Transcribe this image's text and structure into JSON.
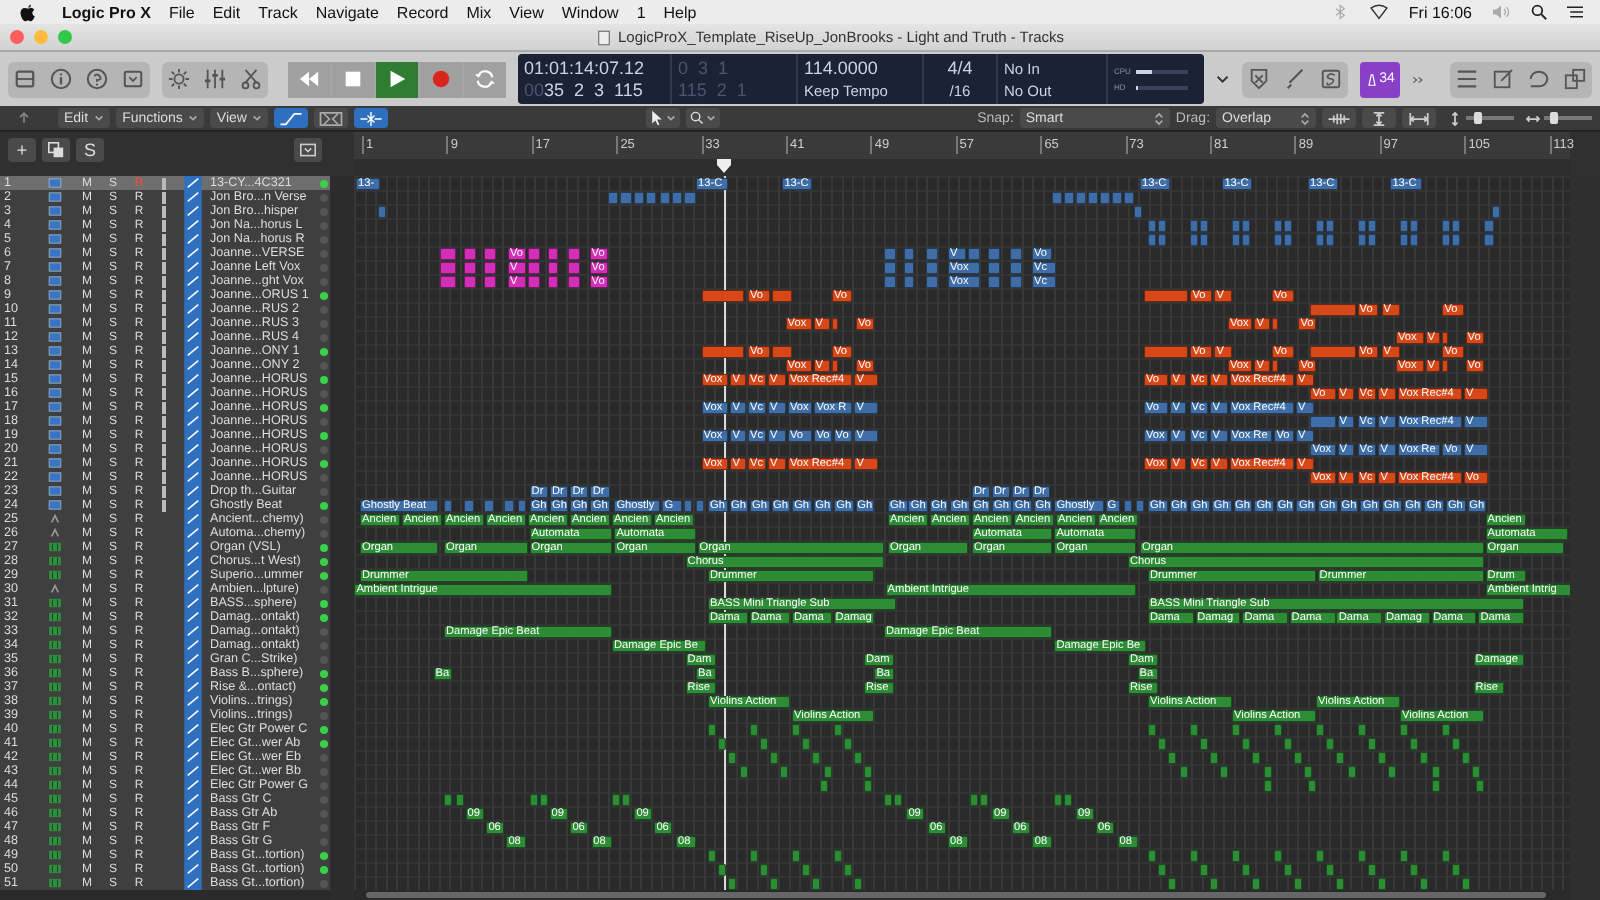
{
  "menubar": {
    "app": "Logic Pro X",
    "items": [
      "File",
      "Edit",
      "Track",
      "Navigate",
      "Record",
      "Mix",
      "View",
      "Window",
      "1",
      "Help"
    ],
    "clock": "Fri 16:06"
  },
  "window": {
    "title": "LogicProX_Template_RiseUp_JonBrooks - Light and Truth - Tracks"
  },
  "lcd": {
    "time": "01:01:14:07.12",
    "bars_prefix": "00",
    "bars": "35  2  3  115",
    "locator_1": "0  3  1",
    "locator_2": "115  2  1",
    "tempo": "114.0000",
    "tempo_mode": "Keep Tempo",
    "signature": "4/4",
    "division": "/16",
    "input": "No In",
    "output": "No Out",
    "meters": [
      {
        "label": "CPU",
        "level": 0.3
      },
      {
        "label": "HD",
        "level": 0.05
      }
    ]
  },
  "tuner_badge": "34",
  "toolbar": {
    "menus": [
      "Edit",
      "Functions",
      "View"
    ],
    "snap_label": "Snap:",
    "snap": "Smart",
    "drag_label": "Drag:",
    "drag": "Overlap",
    "sliders": [
      {
        "level": 0.25
      },
      {
        "level": 0.2
      }
    ]
  },
  "track_header": {
    "add": "+",
    "solo": "S"
  },
  "ruler": [
    "1",
    "9",
    "17",
    "25",
    "33",
    "41",
    "49",
    "57",
    "65",
    "73",
    "81",
    "89",
    "97",
    "105",
    "113"
  ],
  "tracks": [
    {
      "number": "1",
      "name": "13-CY...4C321",
      "kind": "audio",
      "buttons": [
        "M",
        "S",
        "R"
      ],
      "armed": true,
      "selected": true,
      "active": true,
      "color": "#3f6ea6",
      "regions": [
        "13-",
        "13-C",
        "13-C",
        "13-C",
        "13-C",
        "13-C",
        "13-C"
      ]
    },
    {
      "number": "2",
      "name": "Jon Bro...n Verse",
      "kind": "audio",
      "buttons": [
        "M",
        "S",
        "R"
      ],
      "armed": false,
      "selected": false,
      "active": false,
      "color": "#3f6ea6"
    },
    {
      "number": "3",
      "name": "Jon Bro...hisper",
      "kind": "audio",
      "buttons": [
        "M",
        "S",
        "R"
      ],
      "armed": false,
      "selected": false,
      "active": false,
      "color": "#3f6ea6"
    },
    {
      "number": "4",
      "name": "Jon Na...horus L",
      "kind": "audio",
      "buttons": [
        "M",
        "S",
        "R"
      ],
      "armed": false,
      "selected": false,
      "active": false,
      "color": "#3f6ea6"
    },
    {
      "number": "5",
      "name": "Jon Na...horus R",
      "kind": "audio",
      "buttons": [
        "M",
        "S",
        "R"
      ],
      "armed": false,
      "selected": false,
      "active": false,
      "color": "#3f6ea6"
    },
    {
      "number": "6",
      "name": "Joanne...VERSE",
      "kind": "audio",
      "buttons": [
        "M",
        "S",
        "R"
      ],
      "armed": false,
      "selected": false,
      "active": false,
      "color": "#3f6ea6",
      "alt": {
        "color": "#d12fb5"
      },
      "regions": [
        "Vo",
        "Vo",
        "V",
        "Vo"
      ]
    },
    {
      "number": "7",
      "name": "Joanne Left Vox",
      "kind": "audio",
      "buttons": [
        "M",
        "S",
        "R"
      ],
      "armed": false,
      "selected": false,
      "active": false,
      "color": "#3f6ea6",
      "alt": {
        "color": "#d12fb5"
      },
      "regions": [
        "V",
        "Vo",
        "Vox",
        "Vc"
      ]
    },
    {
      "number": "8",
      "name": "Joanne...ght Vox",
      "kind": "audio",
      "buttons": [
        "M",
        "S",
        "R"
      ],
      "armed": false,
      "selected": false,
      "active": false,
      "color": "#3f6ea6",
      "alt": {
        "color": "#d12fb5"
      },
      "regions": [
        "V",
        "Vo",
        "Vox",
        "Vc"
      ]
    },
    {
      "number": "9",
      "name": "Joanne...ORUS 1",
      "kind": "audio",
      "buttons": [
        "M",
        "S",
        "R"
      ],
      "armed": false,
      "selected": false,
      "active": true,
      "color": "#d4481a",
      "regions": [
        "Vo",
        "Vo",
        "Vo",
        "V",
        "Vo"
      ]
    },
    {
      "number": "10",
      "name": "Joanne...RUS 2",
      "kind": "audio",
      "buttons": [
        "M",
        "S",
        "R"
      ],
      "armed": false,
      "selected": false,
      "active": false,
      "color": "#d4481a",
      "regions": [
        "Vo",
        "V",
        "Vo"
      ]
    },
    {
      "number": "11",
      "name": "Joanne...RUS 3",
      "kind": "audio",
      "buttons": [
        "M",
        "S",
        "R"
      ],
      "armed": false,
      "selected": false,
      "active": false,
      "color": "#d4481a",
      "regions": [
        "Vox",
        "V",
        "Vo",
        "Vox",
        "V",
        "Vo"
      ]
    },
    {
      "number": "12",
      "name": "Joanne...RUS 4",
      "kind": "audio",
      "buttons": [
        "M",
        "S",
        "R"
      ],
      "armed": false,
      "selected": false,
      "active": false,
      "color": "#d4481a",
      "regions": [
        "Vox",
        "V",
        "Vo"
      ]
    },
    {
      "number": "13",
      "name": "Joanne...ONY 1",
      "kind": "audio",
      "buttons": [
        "M",
        "S",
        "R"
      ],
      "armed": false,
      "selected": false,
      "active": true,
      "color": "#d4481a",
      "regions": [
        "Vo",
        "Vo",
        "Vo",
        "V",
        "Vo",
        "Vo",
        "V",
        "Vo"
      ]
    },
    {
      "number": "14",
      "name": "Joanne...ONY 2",
      "kind": "audio",
      "buttons": [
        "M",
        "S",
        "R"
      ],
      "armed": false,
      "selected": false,
      "active": false,
      "color": "#d4481a",
      "regions": [
        "Vox",
        "V",
        "Vo",
        "Vox",
        "V",
        "Vo",
        "Vox",
        "V",
        "Vo"
      ]
    },
    {
      "number": "15",
      "name": "Joanne...HORUS",
      "kind": "audio",
      "buttons": [
        "M",
        "S",
        "R"
      ],
      "armed": false,
      "selected": false,
      "active": true,
      "color": "#d4481a",
      "regions": [
        "Vox",
        "V",
        "Vc",
        "V",
        "Vox Rec#4",
        "V",
        "Vo",
        "V",
        "Vc",
        "V",
        "Vox Rec#4",
        "V"
      ]
    },
    {
      "number": "16",
      "name": "Joanne...HORUS",
      "kind": "audio",
      "buttons": [
        "M",
        "S",
        "R"
      ],
      "armed": false,
      "selected": false,
      "active": false,
      "color": "#d4481a",
      "regions": [
        "Vo",
        "V",
        "Vc",
        "V",
        "Vox Rec#4",
        "V"
      ]
    },
    {
      "number": "17",
      "name": "Joanne...HORUS",
      "kind": "audio",
      "buttons": [
        "M",
        "S",
        "R"
      ],
      "armed": false,
      "selected": false,
      "active": true,
      "color": "#3f6ea6",
      "regions": [
        "Vox",
        "V",
        "Vc",
        "V",
        "Vox",
        "Vox R",
        "V",
        "Vo",
        "V",
        "Vc",
        "V",
        "Vox Rec#4",
        "V"
      ]
    },
    {
      "number": "18",
      "name": "Joanne...HORUS",
      "kind": "audio",
      "buttons": [
        "M",
        "S",
        "R"
      ],
      "armed": false,
      "selected": false,
      "active": false,
      "color": "#3f6ea6",
      "regions": [
        "V",
        "Vc",
        "V",
        "Vox Rec#4",
        "V"
      ]
    },
    {
      "number": "19",
      "name": "Joanne...HORUS",
      "kind": "audio",
      "buttons": [
        "M",
        "S",
        "R"
      ],
      "armed": false,
      "selected": false,
      "active": true,
      "color": "#3f6ea6",
      "regions": [
        "Vox",
        "V",
        "Vc",
        "V",
        "Vo",
        "Vo",
        "Vo",
        "V",
        "Vox",
        "V",
        "Vc",
        "V",
        "Vox Re",
        "Vo",
        "V"
      ]
    },
    {
      "number": "20",
      "name": "Joanne...HORUS",
      "kind": "audio",
      "buttons": [
        "M",
        "S",
        "R"
      ],
      "armed": false,
      "selected": false,
      "active": false,
      "color": "#3f6ea6",
      "regions": [
        "Vox",
        "V",
        "Vc",
        "V",
        "Vox Re",
        "Vo",
        "V"
      ]
    },
    {
      "number": "21",
      "name": "Joanne...HORUS",
      "kind": "audio",
      "buttons": [
        "M",
        "S",
        "R"
      ],
      "armed": false,
      "selected": false,
      "active": true,
      "color": "#d4481a",
      "regions": [
        "Vox",
        "V",
        "Vc",
        "V",
        "Vox Rec#4",
        "V",
        "Vox",
        "V",
        "Vc",
        "V",
        "Vox Rec#4",
        "V"
      ]
    },
    {
      "number": "22",
      "name": "Joanne...HORUS",
      "kind": "audio",
      "buttons": [
        "M",
        "S",
        "R"
      ],
      "armed": false,
      "selected": false,
      "active": false,
      "color": "#d4481a",
      "regions": [
        "Vox",
        "V",
        "Vc",
        "V",
        "Vox Rec#4",
        "Vo"
      ]
    },
    {
      "number": "23",
      "name": "Drop th...Guitar",
      "kind": "audio",
      "buttons": [
        "M",
        "S",
        "R"
      ],
      "armed": false,
      "selected": false,
      "active": false,
      "color": "#3f6ea6",
      "regions": [
        "Dr",
        "Dr",
        "Dr",
        "Dr",
        "Dr",
        "Dr",
        "Dr",
        "Dr"
      ]
    },
    {
      "number": "24",
      "name": "Ghostly Beat",
      "kind": "audio",
      "buttons": [
        "M",
        "S",
        "R"
      ],
      "armed": false,
      "selected": false,
      "active": true,
      "color": "#3f6ea6",
      "regions": [
        "Ghostly Beat",
        "Gh",
        "Gh",
        "Gh",
        "Gh",
        "Ghostly",
        "G",
        "Gh",
        "Gh",
        "Gh",
        "Gh",
        "Gh",
        "Gh",
        "Gh",
        "Gh",
        "Gh",
        "Gh",
        "Gh",
        "Gh",
        "Gh",
        "Gh",
        "Gh",
        "Gh",
        "Ghostly",
        "G",
        "Gh",
        "Gh",
        "Gh",
        "Gh",
        "Gh",
        "Gh",
        "Gh",
        "Gh",
        "Gh",
        "Gh",
        "Gh",
        "Gh",
        "Gh",
        "Gh",
        "Gh",
        "Gh"
      ]
    },
    {
      "number": "25",
      "name": "Ancient...chemy)",
      "kind": "aux",
      "buttons": [
        "M",
        "S",
        "R"
      ],
      "armed": false,
      "selected": false,
      "active": false,
      "color": "#2e8b36",
      "regions": [
        "Ancien",
        "Ancien",
        "Ancien",
        "Ancien",
        "Ancien",
        "Ancien",
        "Ancien",
        "Ancien",
        "Ancien",
        "Ancien",
        "Ancien",
        "Ancien",
        "Ancien",
        "Ancien",
        "Ancien"
      ]
    },
    {
      "number": "26",
      "name": "Automa...chemy)",
      "kind": "aux",
      "buttons": [
        "M",
        "S",
        "R"
      ],
      "armed": false,
      "selected": false,
      "active": false,
      "color": "#2e8b36",
      "regions": [
        "Automata",
        "Automata",
        "Automata",
        "Automata",
        "Automata"
      ]
    },
    {
      "number": "27",
      "name": "Organ (VSL)",
      "kind": "instrument",
      "buttons": [
        "M",
        "S",
        "R"
      ],
      "armed": false,
      "selected": false,
      "active": true,
      "color": "#2e8b36",
      "regions": [
        "Organ",
        "Organ",
        "Organ",
        "Organ",
        "Organ",
        "Organ",
        "Organ",
        "Organ",
        "Organ",
        "Organ"
      ]
    },
    {
      "number": "28",
      "name": "Chorus...t West)",
      "kind": "instrument",
      "buttons": [
        "M",
        "S",
        "R"
      ],
      "armed": false,
      "selected": false,
      "active": true,
      "color": "#2e8b36",
      "regions": [
        "Chorus",
        "Chorus"
      ]
    },
    {
      "number": "29",
      "name": "Superio...ummer",
      "kind": "instrument",
      "buttons": [
        "M",
        "S",
        "R"
      ],
      "armed": false,
      "selected": false,
      "active": true,
      "color": "#2e8b36",
      "regions": [
        "Drummer",
        "Drummer",
        "Drummer",
        "Drummer",
        "Drum"
      ]
    },
    {
      "number": "30",
      "name": "Ambien...lpture)",
      "kind": "aux",
      "buttons": [
        "M",
        "S",
        "R"
      ],
      "armed": false,
      "selected": false,
      "active": false,
      "color": "#2e8b36",
      "regions": [
        "Ambient Intrigue",
        "Ambient Intrigue",
        "Ambient Intrig"
      ]
    },
    {
      "number": "31",
      "name": "BASS...sphere)",
      "kind": "instrument",
      "buttons": [
        "M",
        "S",
        "R"
      ],
      "armed": false,
      "selected": false,
      "active": true,
      "color": "#2e8b36",
      "regions": [
        "BASS Mini Triangle Sub",
        "BASS Mini Triangle Sub"
      ]
    },
    {
      "number": "32",
      "name": "Damag...ontakt)",
      "kind": "instrument",
      "buttons": [
        "M",
        "S",
        "R"
      ],
      "armed": false,
      "selected": false,
      "active": true,
      "color": "#2e8b36",
      "regions": [
        "Dama",
        "Dama",
        "Dama",
        "Damag",
        "Dama",
        "Damag",
        "Dama",
        "Dama",
        "Dama",
        "Damag",
        "Dama",
        "Dama"
      ]
    },
    {
      "number": "33",
      "name": "Damag...ontakt)",
      "kind": "instrument",
      "buttons": [
        "M",
        "S",
        "R"
      ],
      "armed": false,
      "selected": false,
      "active": false,
      "color": "#2e8b36",
      "regions": [
        "Damage Epic Beat",
        "Damage Epic Beat"
      ]
    },
    {
      "number": "34",
      "name": "Damag...ontakt)",
      "kind": "instrument",
      "buttons": [
        "M",
        "S",
        "R"
      ],
      "armed": false,
      "selected": false,
      "active": false,
      "color": "#2e8b36",
      "regions": [
        "Damage Epic Be",
        "Damage Epic Be"
      ]
    },
    {
      "number": "35",
      "name": "Gran C...Strike)",
      "kind": "instrument",
      "buttons": [
        "M",
        "S",
        "R"
      ],
      "armed": false,
      "selected": false,
      "active": false,
      "color": "#2e8b36",
      "regions": [
        "Dam",
        "Dam",
        "Dam",
        "Damage"
      ]
    },
    {
      "number": "36",
      "name": "Bass B...sphere)",
      "kind": "instrument",
      "buttons": [
        "M",
        "S",
        "R"
      ],
      "armed": false,
      "selected": false,
      "active": true,
      "color": "#2e8b36",
      "regions": [
        "Ba",
        "Ba",
        "Ba",
        "Ba"
      ]
    },
    {
      "number": "37",
      "name": "Rise &...ontact)",
      "kind": "instrument",
      "buttons": [
        "M",
        "S",
        "R"
      ],
      "armed": false,
      "selected": false,
      "active": true,
      "color": "#2e8b36",
      "regions": [
        "Rise",
        "Rise",
        "Rise",
        "Rise"
      ]
    },
    {
      "number": "38",
      "name": "Violins...trings)",
      "kind": "instrument",
      "buttons": [
        "M",
        "S",
        "R"
      ],
      "armed": false,
      "selected": false,
      "active": true,
      "color": "#2e8b36",
      "regions": [
        "Violins Action",
        "Violins Action",
        "Violins Action"
      ]
    },
    {
      "number": "39",
      "name": "Violins...trings)",
      "kind": "instrument",
      "buttons": [
        "M",
        "S",
        "R"
      ],
      "armed": false,
      "selected": false,
      "active": false,
      "color": "#2e8b36",
      "regions": [
        "Violins Action",
        "Violins Action",
        "Violins Action"
      ]
    },
    {
      "number": "40",
      "name": "Elec Gtr Power C",
      "kind": "instrument",
      "buttons": [
        "M",
        "S",
        "R"
      ],
      "armed": false,
      "selected": false,
      "active": true,
      "color": "#2e8b36"
    },
    {
      "number": "41",
      "name": "Elec Gt...wer Ab",
      "kind": "instrument",
      "buttons": [
        "M",
        "S",
        "R"
      ],
      "armed": false,
      "selected": false,
      "active": true,
      "color": "#2e8b36"
    },
    {
      "number": "42",
      "name": "Elec Gt...wer Eb",
      "kind": "instrument",
      "buttons": [
        "M",
        "S",
        "R"
      ],
      "armed": false,
      "selected": false,
      "active": false,
      "color": "#2e8b36"
    },
    {
      "number": "43",
      "name": "Elec Gt...wer Bb",
      "kind": "instrument",
      "buttons": [
        "M",
        "S",
        "R"
      ],
      "armed": false,
      "selected": false,
      "active": false,
      "color": "#2e8b36"
    },
    {
      "number": "44",
      "name": "Elec Gtr Power G",
      "kind": "instrument",
      "buttons": [
        "M",
        "S",
        "R"
      ],
      "armed": false,
      "selected": false,
      "active": false,
      "color": "#2e8b36"
    },
    {
      "number": "45",
      "name": "Bass Gtr C",
      "kind": "instrument",
      "buttons": [
        "M",
        "S",
        "R"
      ],
      "armed": false,
      "selected": false,
      "active": false,
      "color": "#2e8b36"
    },
    {
      "number": "46",
      "name": "Bass Gtr Ab",
      "kind": "instrument",
      "buttons": [
        "M",
        "S",
        "R"
      ],
      "armed": false,
      "selected": false,
      "active": false,
      "color": "#2e8b36",
      "regions": [
        "09",
        "09",
        "09",
        "09",
        "09",
        "09"
      ]
    },
    {
      "number": "47",
      "name": "Bass Gtr F",
      "kind": "instrument",
      "buttons": [
        "M",
        "S",
        "R"
      ],
      "armed": false,
      "selected": false,
      "active": false,
      "color": "#2e8b36",
      "regions": [
        "06",
        "06",
        "06",
        "06",
        "06",
        "06"
      ]
    },
    {
      "number": "48",
      "name": "Bass Gtr G",
      "kind": "instrument",
      "buttons": [
        "M",
        "S",
        "R"
      ],
      "armed": false,
      "selected": false,
      "active": false,
      "color": "#2e8b36",
      "regions": [
        "08",
        "08",
        "08",
        "08",
        "08",
        "08"
      ]
    },
    {
      "number": "49",
      "name": "Bass Gt...tortion)",
      "kind": "instrument",
      "buttons": [
        "M",
        "S",
        "R"
      ],
      "armed": false,
      "selected": false,
      "active": true,
      "color": "#2e8b36"
    },
    {
      "number": "50",
      "name": "Bass Gt...tortion)",
      "kind": "instrument",
      "buttons": [
        "M",
        "S",
        "R"
      ],
      "armed": false,
      "selected": false,
      "active": true,
      "color": "#2e8b36"
    },
    {
      "number": "51",
      "name": "Bass Gt...tortion)",
      "kind": "instrument",
      "buttons": [
        "M",
        "S",
        "R"
      ],
      "armed": false,
      "selected": false,
      "active": false,
      "color": "#2e8b36"
    }
  ]
}
